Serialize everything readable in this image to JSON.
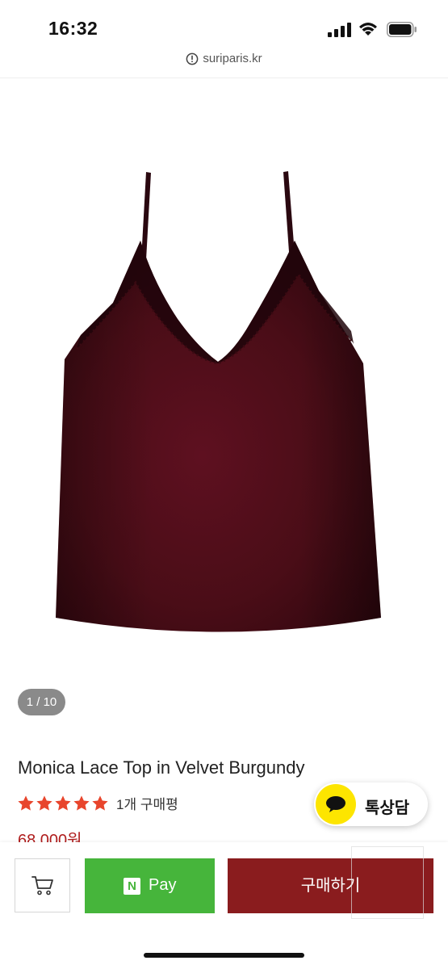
{
  "status_bar": {
    "time": "16:32",
    "icons": [
      "signal-icon",
      "wifi-icon",
      "battery-icon"
    ]
  },
  "browser": {
    "url": "suriparis.kr",
    "url_icon": "info-warning-icon"
  },
  "product": {
    "image_counter": "1 / 10",
    "title": "Monica Lace Top in Velvet Burgundy",
    "rating_stars": 5,
    "review_count": "1개 구매평",
    "price": "68,000원",
    "image_color": "#4a0d17"
  },
  "chat": {
    "label": "톡상담",
    "icon": "chat-bubble-icon",
    "color": "#fde500"
  },
  "bottom_bar": {
    "cart_icon": "cart-icon",
    "npay_logo": "N",
    "npay_label": "Pay",
    "npay_color": "#46b53b",
    "buy_label": "구매하기",
    "buy_color": "#8a1c1e"
  },
  "colors": {
    "accent_red": "#b01e1e",
    "star_color": "#e8452c"
  }
}
